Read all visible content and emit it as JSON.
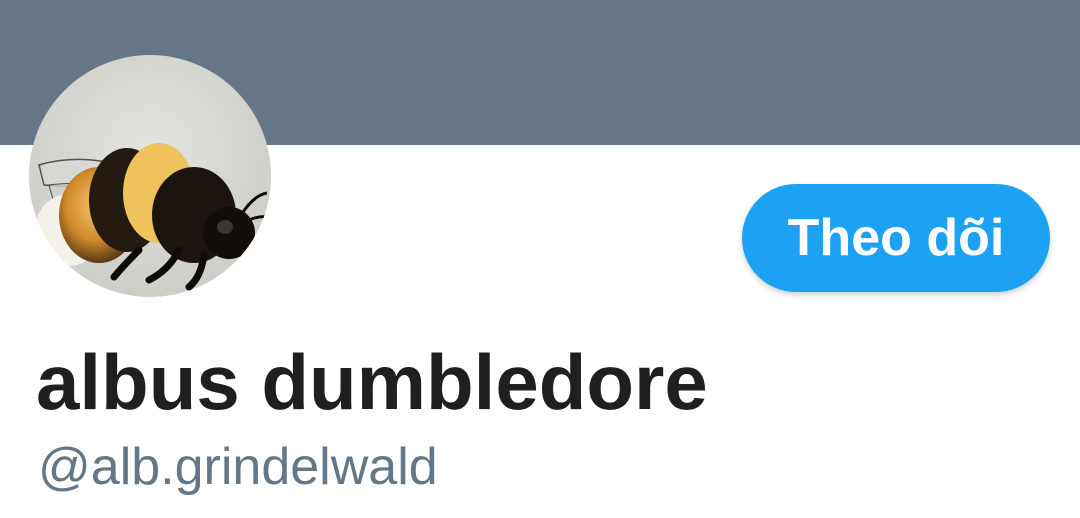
{
  "profile": {
    "display_name": "albus dumbledore",
    "handle": "@alb.grindelwald",
    "avatar_icon": "bumblebee-photo",
    "follow_label": "Theo dõi"
  },
  "colors": {
    "banner": "#657786",
    "accent": "#1da1f2",
    "handle_text": "#657786",
    "name_text": "#1f1f1f"
  }
}
